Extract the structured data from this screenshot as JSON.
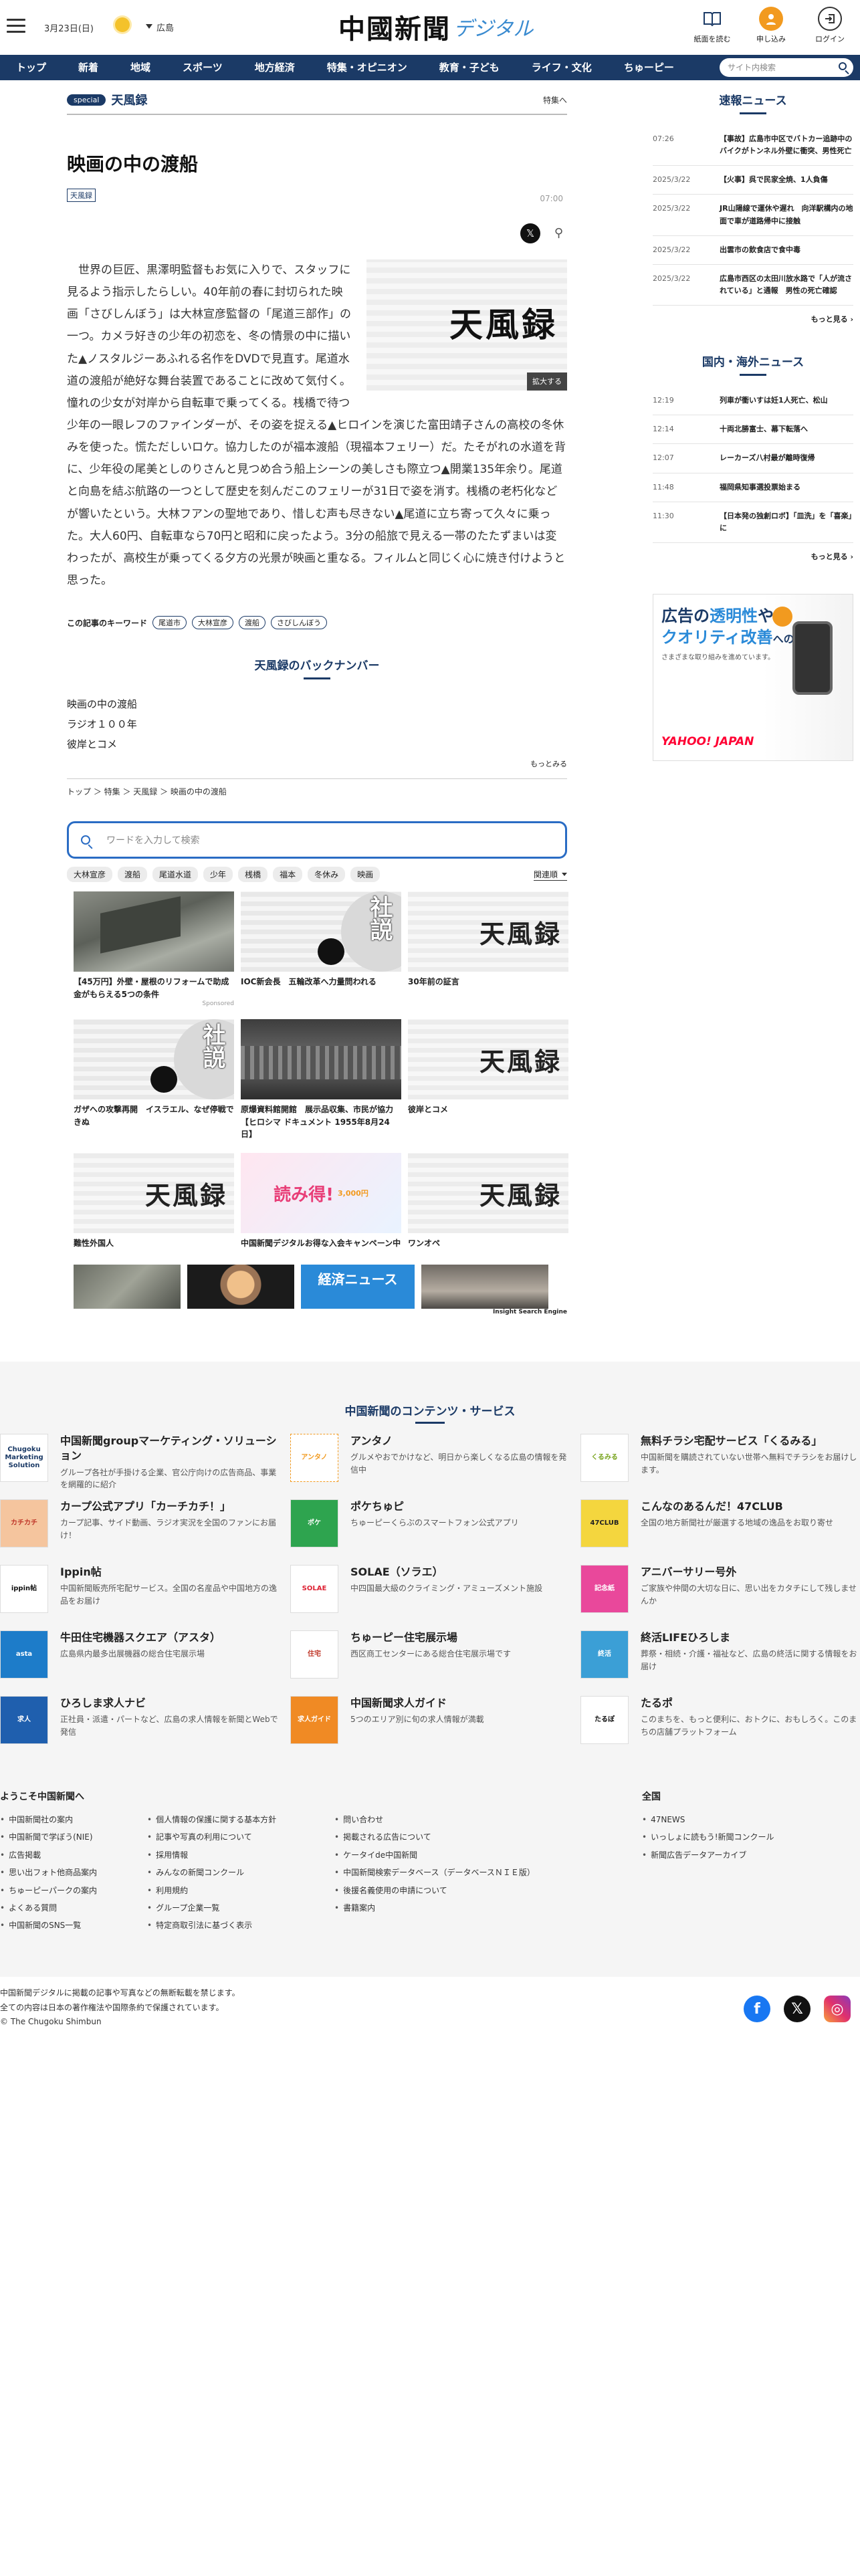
{
  "header": {
    "date": "3月23日(日)",
    "region": "広島",
    "logo_main": "中國新聞",
    "logo_sub": "デジタル",
    "icons": [
      {
        "label": "紙面を読む",
        "icon": "newspaper-icon"
      },
      {
        "label": "申し込み",
        "icon": "subscribe-icon"
      },
      {
        "label": "ログイン",
        "icon": "login-icon"
      }
    ]
  },
  "nav": {
    "items": [
      "トップ",
      "新着",
      "地域",
      "スポーツ",
      "地方経済",
      "特集・オピニオン",
      "教育・子ども",
      "ライフ・文化",
      "ちゅーピー"
    ],
    "search_placeholder": "サイト内検索"
  },
  "article": {
    "section_pill": "special",
    "section_title": "天風録",
    "section_more": "特集へ",
    "title": "映画の中の渡船",
    "tag": "天風録",
    "time": "07:00",
    "figure_text": "天風録",
    "figure_zoom": "拡大する",
    "body": "世界の巨匠、黒澤明監督もお気に入りで、スタッフに見るよう指示したらしい。40年前の春に封切られた映画「さびしんぼう」は大林宣彦監督の「尾道三部作」の一つ。カメラ好きの少年の初恋を、冬の情景の中に描いた▲ノスタルジーあふれる名作をDVDで見直す。尾道水道の渡船が絶好な舞台装置であることに改めて気付く。憧れの少女が対岸から自転車で乗ってくる。桟橋で待つ少年の一眼レフのファインダーが、その姿を捉える▲ヒロインを演じた富田靖子さんの高校の冬休みを使った。慌ただしいロケ。協力したのが福本渡船（現福本フェリー）だ。たそがれの水道を背に、少年役の尾美としのりさんと見つめ合う船上シーンの美しさも際立つ▲開業135年余り。尾道と向島を結ぶ航路の一つとして歴史を刻んだこのフェリーが31日で姿を消す。桟橋の老朽化などが響いたという。大林フアンの聖地であり、惜しむ声も尽きない▲尾道に立ち寄って久々に乗った。大人60円、自転車なら70円と昭和に戻ったよう。3分の船旅で見える一帯のたたずまいは変わったが、高校生が乗ってくる夕方の光景が映画と重なる。フィルムと同じく心に焼き付けようと思った。",
    "keywords_label": "この記事のキーワード",
    "keywords": [
      "尾道市",
      "大林宣彦",
      "渡船",
      "さびしんぼう"
    ]
  },
  "backnumber": {
    "title": "天風録のバックナンバー",
    "items": [
      "映画の中の渡船",
      "ラジオ１００年",
      "彼岸とコメ"
    ],
    "more": "もっとみる"
  },
  "breadcrumb": "トップ ＞ 特集 ＞ 天風録 ＞ 映画の中の渡船",
  "search": {
    "placeholder": "ワードを入力して検索",
    "tags": [
      "大林宣彦",
      "渡船",
      "尾道水道",
      "少年",
      "桟橋",
      "福本",
      "冬休み",
      "映画"
    ],
    "sort": "関連順"
  },
  "cards": [
    {
      "kind": "photo1",
      "title": "【45万円】外壁・屋根のリフォームで助成金がもらえる5つの条件",
      "sponsor": "Sponsored"
    },
    {
      "kind": "shasetsu",
      "title": "IOC新会長　五輪改革へ力量問われる",
      "sponsor": ""
    },
    {
      "kind": "kanji",
      "title": "30年前の証言",
      "sponsor": ""
    },
    {
      "kind": "shasetsu",
      "title": "ガザへの攻撃再開　イスラエル、なぜ停戦できぬ",
      "sponsor": ""
    },
    {
      "kind": "photo2",
      "title": "原爆資料館開館　展示品収集、市民が協力【ヒロシマ ドキュメント 1955年8月24日】",
      "sponsor": ""
    },
    {
      "kind": "kanji",
      "title": "彼岸とコメ",
      "sponsor": ""
    },
    {
      "kind": "kanji",
      "title": "難性外国人",
      "sponsor": ""
    },
    {
      "kind": "ad",
      "title": "中国新聞デジタルお得な入会キャンペーン中",
      "sponsor": ""
    },
    {
      "kind": "kanji",
      "title": "ワンオペ",
      "sponsor": ""
    }
  ],
  "kanji_text": "天風録",
  "shasetsu_text": "社説",
  "ad_text": "読み得!",
  "ad_sub": "3,000円",
  "ise": {
    "label": "Insight Search Engine",
    "banner": "経済ニュース"
  },
  "sidebar": {
    "quick_title": "速報ニュース",
    "quick": [
      {
        "time": "07:26",
        "headline": "【事故】広島市中区でバトカー追跡中のバイクがトンネル外壁に衝突、男性死亡"
      },
      {
        "time": "2025/3/22",
        "headline": "【火事】呉で民家全焼、1人負傷"
      },
      {
        "time": "2025/3/22",
        "headline": "JR山陽線で運休や遅れ　向洋駅構内の地面で車が道路帰中に接触"
      },
      {
        "time": "2025/3/22",
        "headline": "出雲市の飲食店で食中毒"
      },
      {
        "time": "2025/3/22",
        "headline": "広島市西区の太田川放水路で「人が流されている」と通報　男性の死亡確認"
      }
    ],
    "quick_more": "もっと見る",
    "world_title": "国内・海外ニュース",
    "world": [
      {
        "time": "12:19",
        "headline": "列車が衝いすは妊1人死亡、松山"
      },
      {
        "time": "12:14",
        "headline": "十両北勝富士、幕下転落へ"
      },
      {
        "time": "12:07",
        "headline": "レーカーズ八村最が離時復帰"
      },
      {
        "time": "11:48",
        "headline": "福岡県知事選投票始まる"
      },
      {
        "time": "11:30",
        "headline": "【日本発の独創ロボ】「皿洗」を「喜楽」に"
      }
    ],
    "world_more": "もっと見る",
    "ad": {
      "line1a": "広告の",
      "line1b": "透明性",
      "line1c": "や",
      "line2a": "クオリティ改善",
      "line2b": "への",
      "line3": "さまざまな取り組みを進めています。",
      "brand": "YAHOO! JAPAN"
    }
  },
  "services": {
    "title": "中国新聞のコンテンツ・サービス",
    "items": [
      {
        "logo": "Chugoku Marketing Solution",
        "name": "中国新聞groupマーケティング・ソリューション",
        "desc": "グループ各社が手掛ける企業、官公庁向けの広告商品、事業を網羅的に紹介"
      },
      {
        "logo": "アンタノ",
        "name": "アンタノ",
        "desc": "グルメやおでかけなど、明日から楽しくなる広島の情報を発信中"
      },
      {
        "logo": "くるみる",
        "name": "無料チラシ宅配サービス「くるみる」",
        "desc": "中国新聞を購読されていない世帯へ無料でチラシをお届けします。"
      },
      {
        "logo": "カチカチ",
        "name": "カープ公式アプリ「カーチカチ！」",
        "desc": "カープ記事、サイド動画、ラジオ実況を全国のファンにお届け！"
      },
      {
        "logo": "ポケ",
        "name": "ポケちゅピ",
        "desc": "ちゅーピーくらぶのスマートフォン公式アプリ"
      },
      {
        "logo": "47CLUB",
        "name": "こんなのあるんだ！47CLUB",
        "desc": "全国の地方新聞社が厳選する地域の逸品をお取り寄せ"
      },
      {
        "logo": "ippin帖",
        "name": "Ippin帖",
        "desc": "中国新聞販売所宅配サービス。全国の名産品や中国地方の逸品をお届け"
      },
      {
        "logo": "SOLAE",
        "name": "SOLAE（ソラエ）",
        "desc": "中四国最大級のクライミング・アミューズメント施設"
      },
      {
        "logo": "記念紙",
        "name": "アニバーサリー号外",
        "desc": "ご家族や仲間の大切な日に、思い出をカタチにして残しませんか"
      },
      {
        "logo": "asta",
        "name": "牛田住宅機器スクエア（アスタ）",
        "desc": "広島県内最多出展機器の総合住宅展示場"
      },
      {
        "logo": "住宅",
        "name": "ちゅーピー住宅展示場",
        "desc": "西区商工センターにある総合住宅展示場です"
      },
      {
        "logo": "終活",
        "name": "終活LIFEひろしま",
        "desc": "葬祭・相続・介護・福祉など、広島の終活に関する情報をお届け"
      },
      {
        "logo": "求人",
        "name": "ひろしま求人ナビ",
        "desc": "正社員・派遣・パートなど、広島の求人情報を新聞とWebで発信"
      },
      {
        "logo": "求人ガイド",
        "name": "中国新聞求人ガイド",
        "desc": "5つのエリア別に旬の求人情報が満載"
      },
      {
        "logo": "たるぽ",
        "name": "たるポ",
        "desc": "このまちを、もっと便利に、おトクに、おもしろく。このまちの店舗プラットフォーム"
      }
    ]
  },
  "about": {
    "title": "ようこそ中国新聞へ",
    "col1": [
      "中国新聞社の案内",
      "中国新聞で学ぼう(NIE)",
      "広告掲載",
      "思い出フォト他商品案内",
      "ちゅーピーパークの案内",
      "よくある質問",
      "中国新聞のSNS一覧"
    ],
    "col2": [
      "個人情報の保護に関する基本方針",
      "記事や写真の利用について",
      "採用情報",
      "みんなの新聞コンクール",
      "利用規約",
      "グループ企業一覧",
      "特定商取引法に基づく表示"
    ],
    "col3": [
      "問い合わせ",
      "掲載される広告について",
      "ケータイde中国新聞",
      "中国新聞検索データベース（データベースＮＩＥ版）",
      "後援名義使用の申請について",
      "書籍案内"
    ],
    "nat_title": "全国",
    "col4": [
      "47NEWS",
      "いっしょに読もう!新聞コンクール",
      "新聞広告データアーカイブ"
    ]
  },
  "copyright": {
    "l1": "中国新聞デジタルに掲載の記事や写真などの無断転載を禁じます。",
    "l2": "全ての内容は日本の著作権法や国際条約で保護されています。",
    "l3": "© The Chugoku Shimbun"
  }
}
